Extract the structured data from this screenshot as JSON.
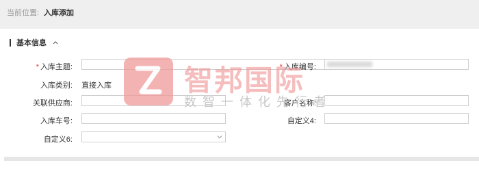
{
  "breadcrumb": {
    "label": "当前位置:",
    "current": "入库添加"
  },
  "section": {
    "title": "基本信息"
  },
  "form": {
    "subject_label": "入库主题:",
    "number_label": "入库编号:",
    "type_label": "入库类别:",
    "type_value": "直接入库",
    "supplier_label": "关联供应商:",
    "customer_label": "客户名称:",
    "vehicle_label": "入库车号:",
    "custom4_label": "自定义4:",
    "custom6_label": "自定义6:",
    "required_mark": "*"
  },
  "watermark": {
    "title": "智邦国际",
    "subtitle": "数智一体化先行者"
  },
  "colors": {
    "required": "#e03131",
    "watermark": "#f19a9a",
    "topbar": "#efefef",
    "border": "#cfcfcf"
  },
  "icons": {
    "section_toggle": "chevron-up-icon",
    "select_arrow": "chevron-down-icon"
  }
}
